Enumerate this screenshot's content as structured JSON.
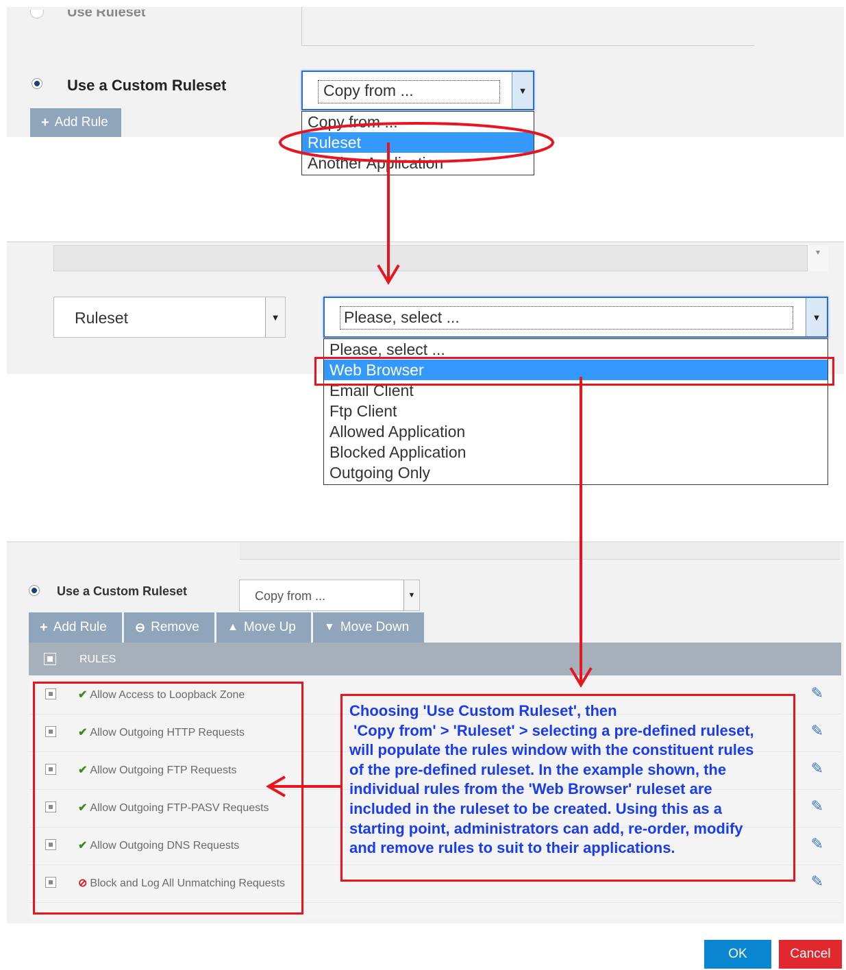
{
  "section1": {
    "top_partial_label": "Use Ruleset",
    "custom_ruleset_label": "Use a Custom Ruleset",
    "add_rule": "Add Rule",
    "copy_from_value": "Copy from ...",
    "dropdown_items": [
      "Copy from ...",
      "Ruleset",
      "Another Application"
    ],
    "selected_index": 1
  },
  "section2": {
    "ruleset_value": "Ruleset",
    "select_value": "Please, select ...",
    "dropdown_items": [
      "Please, select ...",
      "Web Browser",
      "Email Client",
      "Ftp Client",
      "Allowed Application",
      "Blocked Application",
      "Outgoing Only"
    ],
    "selected_index": 1
  },
  "section3": {
    "custom_ruleset_label": "Use a Custom Ruleset",
    "copy_from_value": "Copy from ...",
    "toolbar": {
      "add_rule": "Add Rule",
      "remove": "Remove",
      "move_up": "Move Up",
      "move_down": "Move Down"
    },
    "table_header": "RULES",
    "rules": [
      {
        "status": "allow",
        "name": "Allow Access to Loopback Zone"
      },
      {
        "status": "allow",
        "name": "Allow Outgoing HTTP Requests"
      },
      {
        "status": "allow",
        "name": "Allow Outgoing FTP Requests"
      },
      {
        "status": "allow",
        "name": "Allow Outgoing FTP-PASV Requests"
      },
      {
        "status": "allow",
        "name": "Allow Outgoing DNS Requests"
      },
      {
        "status": "block",
        "name": "Block and Log All Unmatching Requests"
      }
    ],
    "ok": "OK",
    "cancel": "Cancel"
  },
  "annotation": "Choosing 'Use Custom Ruleset', then\n 'Copy from' > 'Ruleset' > selecting a pre-defined ruleset,\nwill populate the rules window with the constituent rules\nof the pre-defined ruleset. In the example shown, the\nindividual rules from the 'Web Browser' ruleset are\nincluded in the ruleset to be created. Using this as a\nstarting point, administrators can add, re-order, modify\nand remove rules to suit to their applications.",
  "colors": {
    "button_gray": "#8ea5bb",
    "highlight_blue": "#3399ff",
    "annotation_red": "#e8141e",
    "annotation_text": "#1a3cf0",
    "ok_blue": "#0a86d0",
    "cancel_red": "#e0282e"
  },
  "icons": {
    "add": "plus-icon",
    "remove": "minus-circle-icon",
    "move_up": "arrow-up-circle-icon",
    "move_down": "arrow-down-circle-icon",
    "allow": "checkmark-icon",
    "block": "prohibited-icon",
    "edit": "pencil-icon"
  }
}
